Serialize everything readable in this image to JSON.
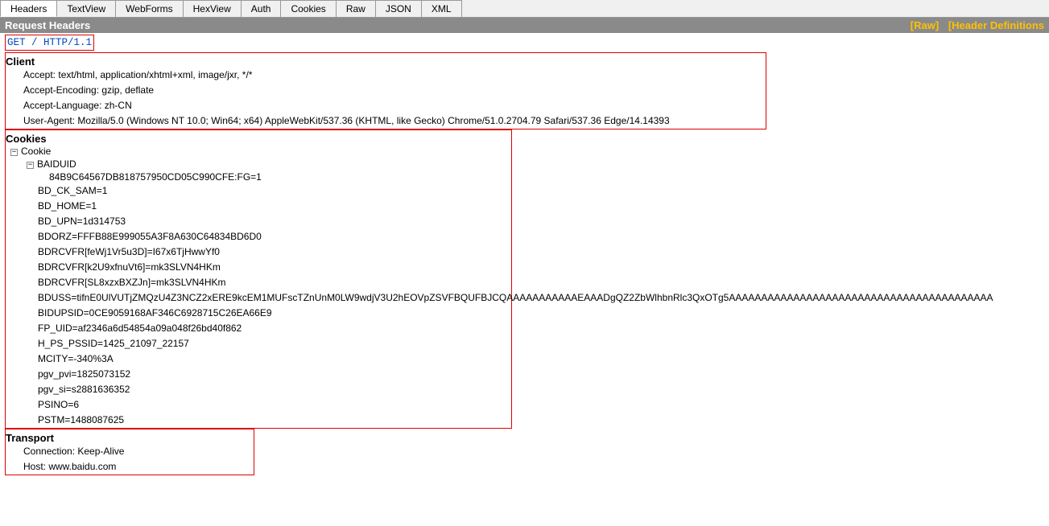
{
  "tabs": {
    "items": [
      "Headers",
      "TextView",
      "WebForms",
      "HexView",
      "Auth",
      "Cookies",
      "Raw",
      "JSON",
      "XML"
    ],
    "active": 0
  },
  "subheader": {
    "title": "Request Headers",
    "raw_link": "[Raw]",
    "defs_link": "[Header Definitions"
  },
  "request_line": "GET / HTTP/1.1",
  "client": {
    "title": "Client",
    "items": [
      "Accept: text/html, application/xhtml+xml, image/jxr, */*",
      "Accept-Encoding: gzip, deflate",
      "Accept-Language: zh-CN",
      "User-Agent: Mozilla/5.0 (Windows NT 10.0; Win64; x64) AppleWebKit/537.36 (KHTML, like Gecko) Chrome/51.0.2704.79 Safari/537.36 Edge/14.14393"
    ]
  },
  "cookies": {
    "title": "Cookies",
    "root_label": "Cookie",
    "baiduid_label": "BAIDUID",
    "baiduid_value": "84B9C64567DB818757950CD05C990CFE:FG=1",
    "items": [
      "BD_CK_SAM=1",
      "BD_HOME=1",
      "BD_UPN=1d314753",
      "BDORZ=FFFB88E999055A3F8A630C64834BD6D0",
      "BDRCVFR[feWj1Vr5u3D]=I67x6TjHwwYf0",
      "BDRCVFR[k2U9xfnuVt6]=mk3SLVN4HKm",
      "BDRCVFR[SL8xzxBXZJn]=mk3SLVN4HKm",
      "BDUSS=tifnE0UlVUTjZMQzU4Z3NCZ2xERE9kcEM1MUFscTZnUnM0LW9wdjV3U2hEOVpZSVFBQUFBJCQAAAAAAAAAAAEAAADgQZ2ZbWlhbnRlc3QxOTg5AAAAAAAAAAAAAAAAAAAAAAAAAAAAAAAAAAAAAAAAA",
      "BIDUPSID=0CE9059168AF346C6928715C26EA66E9",
      "FP_UID=af2346a6d54854a09a048f26bd40f862",
      "H_PS_PSSID=1425_21097_22157",
      "MCITY=-340%3A",
      "pgv_pvi=1825073152",
      "pgv_si=s2881636352",
      "PSINO=6",
      "PSTM=1488087625"
    ]
  },
  "transport": {
    "title": "Transport",
    "items": [
      "Connection: Keep-Alive",
      "Host: www.baidu.com"
    ]
  }
}
